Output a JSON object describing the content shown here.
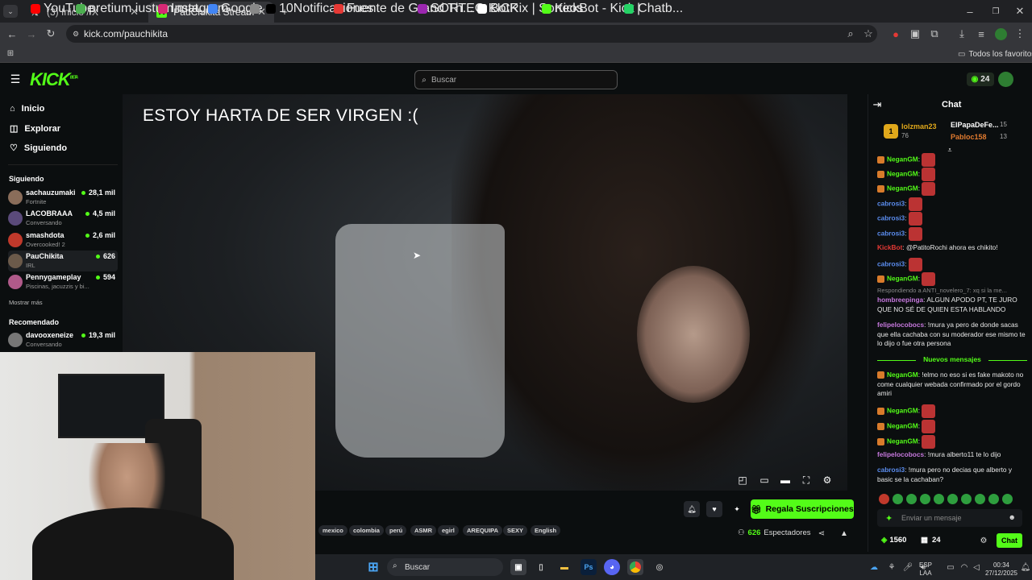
{
  "browser": {
    "tabs": [
      {
        "label": "(3) Inicio / X",
        "icon": "x-icon"
      },
      {
        "label": "PauChikita Stream - Watch Live",
        "icon": "kick-icon"
      }
    ],
    "url": "kick.com/pauchikita",
    "bookmarks": [
      {
        "label": "YouTube",
        "color": "#ff0000"
      },
      {
        "label": "pretium iustum mat...",
        "color": "#4caf50"
      },
      {
        "label": "Instagram",
        "color": "#d62976"
      },
      {
        "label": "Google",
        "color": "#4285f4"
      },
      {
        "label": "",
        "color": "#888888"
      },
      {
        "label": "10Notificaciones",
        "color": "#000000"
      },
      {
        "label": "Fuente de Grand Th...",
        "color": "#e53935"
      },
      {
        "label": "SORTEO KICK",
        "color": "#9c27b0"
      },
      {
        "label": "BotRix | Sorteos",
        "color": "#ffffff"
      },
      {
        "label": "KickBot - Kick Chatb...",
        "color": "#53fc18"
      },
      {
        "label": "|",
        "color": "#25d366"
      }
    ],
    "all_bookmarks": "Todos los favoritos"
  },
  "kick": {
    "logo": "KICK",
    "logo_sup": "BETA",
    "search_placeholder": "Buscar",
    "coins": "24",
    "nav": [
      {
        "label": "Inicio",
        "icon": "home-icon"
      },
      {
        "label": "Explorar",
        "icon": "compass-icon"
      },
      {
        "label": "Siguiendo",
        "icon": "heart-icon"
      }
    ],
    "following_title": "Siguiendo",
    "following": [
      {
        "name": "sachauzumaki",
        "game": "Fortnite",
        "viewers": "28,1 mil",
        "color": "#8a6d5a"
      },
      {
        "name": "LACOBRAAA",
        "game": "Conversando",
        "viewers": "4,5 mil",
        "color": "#5a4a7a"
      },
      {
        "name": "smashdota",
        "game": "Overcooked! 2",
        "viewers": "2,6 mil",
        "color": "#c0392b"
      },
      {
        "name": "PauChikita",
        "game": "IRL",
        "viewers": "626",
        "color": "#6b5a4a"
      },
      {
        "name": "Pennygameplay",
        "game": "Piscinas, jacuzzis y bi...",
        "viewers": "594",
        "color": "#b05a8a"
      }
    ],
    "show_more": "Mostrar más",
    "recommended_title": "Recomendado",
    "recommended": [
      {
        "name": "davooxeneize",
        "game": "Conversando",
        "viewers": "19,3 mil",
        "color": "#777777"
      }
    ],
    "stream_overlay": "ESTOY HARTA DE SER VIRGEN :(",
    "tags": [
      "mexico",
      "colombia",
      "perú",
      "ASMR",
      "egirl",
      "AREQUIPA",
      "SEXY",
      "English"
    ],
    "gift_button": "Regala Suscripciones",
    "viewers": "626",
    "viewers_label": "Espectadores"
  },
  "chat": {
    "title": "Chat",
    "leaders": [
      {
        "name": "lolzman23",
        "count": "76"
      },
      {
        "name": "ElPapaDeFe...",
        "count": "15"
      },
      {
        "name": "Pabloc158",
        "count": "13"
      }
    ],
    "messages": [
      {
        "user": "NeganGM",
        "color": "#53fc18",
        "text": "",
        "emote": true
      },
      {
        "user": "NeganGM",
        "color": "#53fc18",
        "text": "",
        "emote": true
      },
      {
        "user": "NeganGM",
        "color": "#53fc18",
        "text": "",
        "emote": true
      },
      {
        "user": "cabrosi3",
        "color": "#5b8def",
        "text": "",
        "emote": true
      },
      {
        "user": "cabrosi3",
        "color": "#5b8def",
        "text": "",
        "emote": true
      },
      {
        "user": "cabrosi3",
        "color": "#5b8def",
        "text": "",
        "emote": true
      },
      {
        "user": "KickBot",
        "color": "#e53935",
        "text": "@PatitoRochi ahora es chikito!",
        "emote": false
      },
      {
        "user": "cabrosi3",
        "color": "#5b8def",
        "text": "",
        "emote": true
      },
      {
        "user": "NeganGM",
        "color": "#53fc18",
        "text": "",
        "emote": true
      }
    ],
    "reply_note": "Respondiendo a ANTI_novelero_7: xq si la me...",
    "messages2": [
      {
        "user": "hombreepinga",
        "color": "#c678dd",
        "text": "ALGUN APODO PT, TE JURO QUE NO SÉ DE QUIEN ESTA HABLANDO"
      },
      {
        "user": "felipelocobocs",
        "color": "#c678dd",
        "text": "!mura ya pero de donde sacas que ella cachaba con su moderador ese mismo te lo dijo o fue otra persona"
      }
    ],
    "new_messages": "Nuevos mensajes",
    "messages3": [
      {
        "user": "NeganGM",
        "color": "#53fc18",
        "text": "!elmo no eso si es fake makoto no come cualquier webada confirmado por el gordo amiri"
      }
    ],
    "messages4": [
      {
        "user": "NeganGM",
        "color": "#53fc18",
        "text": ""
      },
      {
        "user": "NeganGM",
        "color": "#53fc18",
        "text": ""
      },
      {
        "user": "NeganGM",
        "color": "#53fc18",
        "text": ""
      },
      {
        "user": "felipelocobocs",
        "color": "#c678dd",
        "text": "!mura alberto11 te lo dijo"
      },
      {
        "user": "cabrosi3",
        "color": "#5b8def",
        "text": "!mura pero no decias que alberto y basic se la cachaban?"
      }
    ],
    "input_placeholder": "Enviar un mensaje",
    "points": "1560",
    "calendar_count": "24",
    "send_label": "Chat"
  },
  "taskbar": {
    "search": "Buscar",
    "lang": "ESP",
    "lang2": "LAA",
    "time": "00:34",
    "date": "27/12/2025"
  }
}
